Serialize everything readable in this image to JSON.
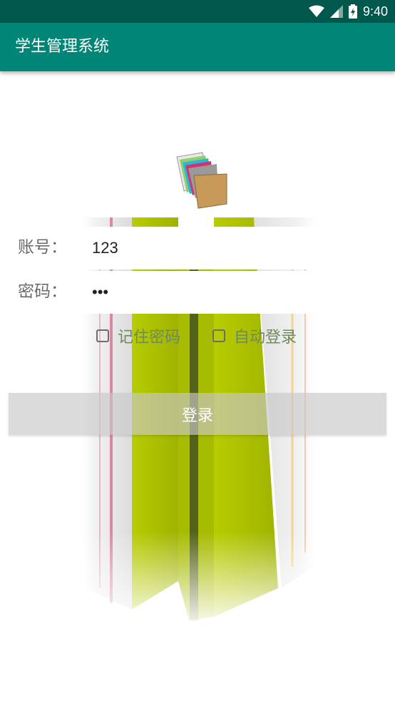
{
  "status_bar": {
    "time": "9:40",
    "icons": [
      "wifi-icon",
      "signal-icon",
      "battery-icon"
    ]
  },
  "app_bar": {
    "title": "学生管理系统"
  },
  "logo": {
    "icon": "books-icon"
  },
  "form": {
    "account_label": "账号：",
    "account_value": "123",
    "password_label": "密码：",
    "password_value": "123",
    "remember_label": "记住密码",
    "auto_login_label": "自动登录",
    "login_button": "登录"
  },
  "colors": {
    "status_bar": "#00574b",
    "app_bar": "#008577",
    "book_green": "#b4c800"
  }
}
